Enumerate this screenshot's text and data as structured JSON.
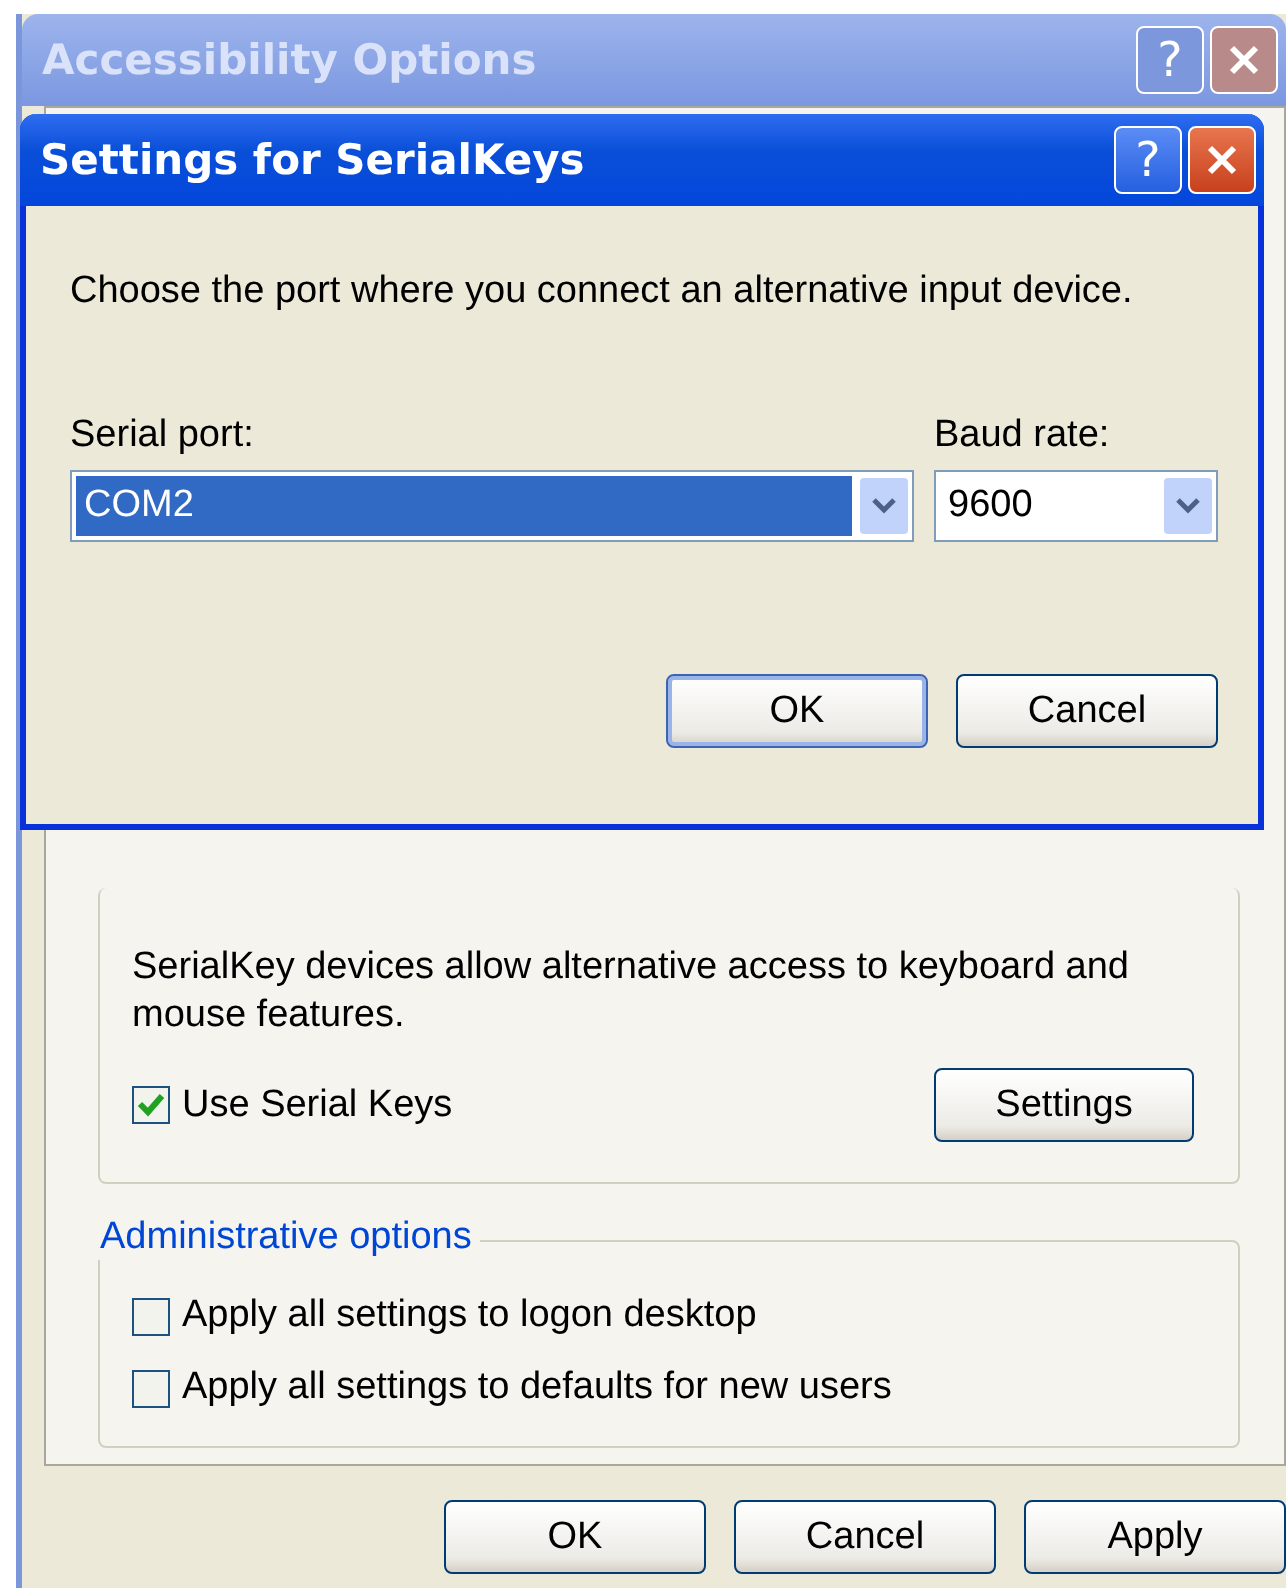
{
  "back_window": {
    "title": "Accessibility Options",
    "active": false,
    "help_button": "?",
    "serialkey_group": {
      "description": "SerialKey devices allow alternative access to keyboard and mouse features.",
      "use_serial_keys": {
        "label": "Use Serial Keys",
        "checked": true
      },
      "settings_button": "Settings"
    },
    "admin_group": {
      "legend": "Administrative options",
      "options": [
        {
          "label": "Apply all settings to logon desktop",
          "checked": false
        },
        {
          "label": "Apply all settings to defaults for new users",
          "checked": false
        }
      ]
    },
    "buttons": [
      "OK",
      "Cancel",
      "Apply"
    ]
  },
  "dialog": {
    "title": "Settings for SerialKeys",
    "active": true,
    "help_button": "?",
    "instruction": "Choose the port where you connect an alternative input device.",
    "serial_port": {
      "label": "Serial port:",
      "value": "COM2",
      "focused": true
    },
    "baud_rate": {
      "label": "Baud rate:",
      "value": "9600",
      "focused": false
    },
    "buttons": [
      "OK",
      "Cancel"
    ]
  }
}
